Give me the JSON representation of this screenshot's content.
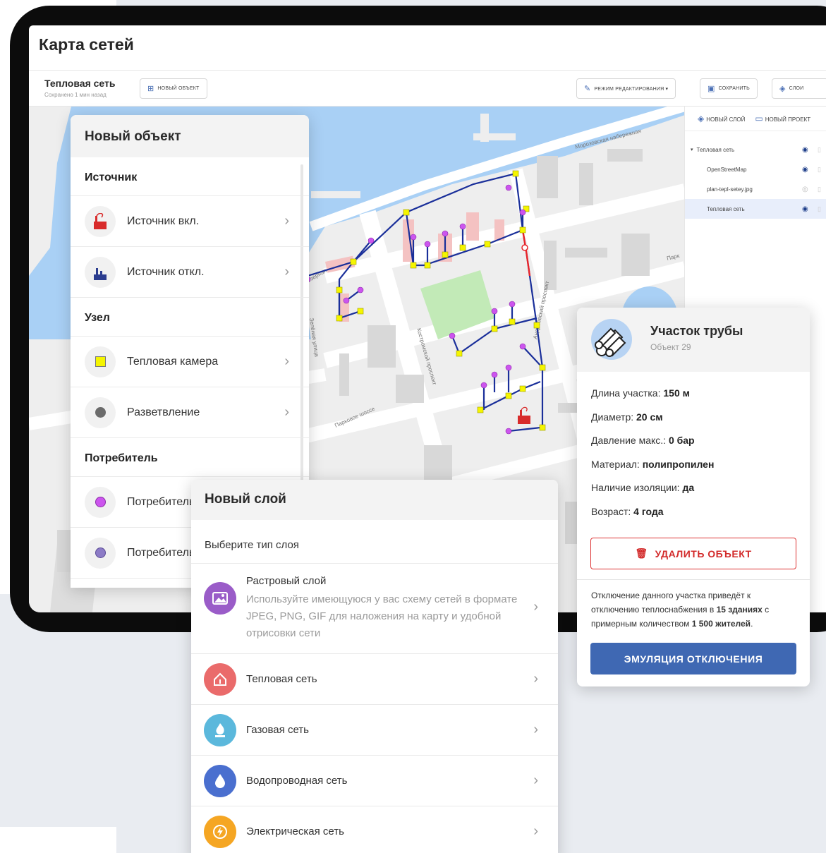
{
  "screen": {
    "title": "Карта сетей"
  },
  "toolbar": {
    "title": "Тепловая сеть",
    "subtitle": "Сохранено 1 мин назад",
    "new_object_label": "новый объект",
    "edit_mode_label": "режим редактирования ▾",
    "save_label": "сохранить",
    "layers_label": "слои"
  },
  "map_labels": {
    "embankment": "Морозовская набережная",
    "kostroma_prospect": "Костромской проспект",
    "andreev_prospect": "Андреевский проспект",
    "park_highway": "Парковое шоссе",
    "lane_left": "Озёрная",
    "street_left": "Зелёная улица",
    "park_right": "Парк"
  },
  "layers_panel": {
    "new_layer_label": "новый слой",
    "new_project_label": "новый проект",
    "items": [
      {
        "label": "Тепловая сеть",
        "visible": true,
        "group": true
      },
      {
        "label": "OpenStreetMap",
        "visible": true,
        "group": false
      },
      {
        "label": "plan-tepl-setey.jpg",
        "visible": false,
        "group": false
      },
      {
        "label": "Тепловая сеть",
        "visible": true,
        "group": false,
        "selected": true
      }
    ]
  },
  "new_object_panel": {
    "title": "Новый объект",
    "sections": [
      {
        "title": "Источник",
        "items": [
          {
            "label": "Источник вкл.",
            "icon": "source-on-icon"
          },
          {
            "label": "Источник откл.",
            "icon": "source-off-icon"
          }
        ]
      },
      {
        "title": "Узел",
        "items": [
          {
            "label": "Тепловая камера",
            "icon": "yellow-square-icon",
            "color": "#f5f500"
          },
          {
            "label": "Разветвление",
            "icon": "gray-circle-icon",
            "color": "#6b6b6b"
          }
        ]
      },
      {
        "title": "Потребитель",
        "items": [
          {
            "label": "Потребитель",
            "icon": "purple-circle-icon",
            "color": "#cc55ee"
          },
          {
            "label": "Потребитель",
            "icon": "violet-circle-icon",
            "color": "#8c7bc6"
          }
        ]
      }
    ]
  },
  "new_layer_panel": {
    "title": "Новый слой",
    "subtitle": "Выберите тип слоя",
    "items": [
      {
        "title": "Растровый слой",
        "description": "Используйте имеющуюся у вас схему сетей в формате JPEG, PNG, GIF для наложения на карту и удобной отрисовки сети",
        "icon": "image-icon",
        "color": "#9a5cc8"
      },
      {
        "title": "Тепловая сеть",
        "icon": "house-heat-icon",
        "color": "#ea6b6b"
      },
      {
        "title": "Газовая сеть",
        "icon": "gas-flame-icon",
        "color": "#5bb8dc"
      },
      {
        "title": "Водопроводная сеть",
        "icon": "water-drop-icon",
        "color": "#4a6fcf"
      },
      {
        "title": "Электрическая сеть",
        "icon": "lightning-icon",
        "color": "#f5a623"
      }
    ]
  },
  "pipe_panel": {
    "title": "Участок трубы",
    "subtitle": "Объект 29",
    "props": [
      {
        "label": "Длина участка: ",
        "value": "150 м"
      },
      {
        "label": "Диаметр: ",
        "value": "20 см"
      },
      {
        "label": "Давление макс.: ",
        "value": "0 бар"
      },
      {
        "label": "Материал: ",
        "value": "полипропилен"
      },
      {
        "label": "Наличие изоляции: ",
        "value": "да"
      },
      {
        "label": "Возраст: ",
        "value": "4 года"
      }
    ],
    "delete_label": "УДАЛИТЬ ОБЪЕКТ",
    "note_1": "Отключение данного участка приведёт к отключению теплоснабжения в ",
    "note_bold_1": "15 зданиях",
    "note_2": " с примерным количеством ",
    "note_bold_2": "1 500 жителей",
    "note_3": ".",
    "emulate_label": "ЭМУЛЯЦИЯ ОТКЛЮЧЕНИЯ"
  },
  "colors": {
    "accent_blue": "#3f68b3",
    "danger_red": "#d32b2b",
    "pipe_blue": "#1a2f9a",
    "pipe_red": "#e8242a",
    "node_yellow": "#f5f500",
    "consumer_purple": "#cc55ee"
  }
}
